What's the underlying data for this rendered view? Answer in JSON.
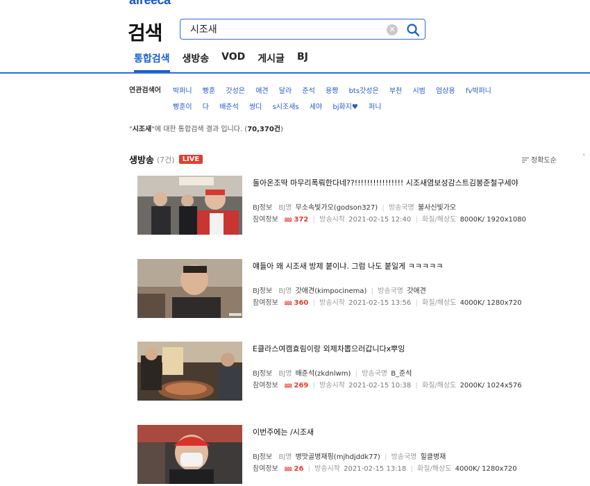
{
  "header": {
    "logo_text": "afreeca",
    "title": "검색"
  },
  "search": {
    "value": "시조새",
    "clear_icon": "clear-icon",
    "button_icon": "search-icon",
    "accent": "#2a6ce0"
  },
  "tabs": [
    {
      "label": "통합검색",
      "active": true
    },
    {
      "label": "생방송"
    },
    {
      "label": "VOD"
    },
    {
      "label": "게시글"
    },
    {
      "label": "BJ"
    }
  ],
  "related": {
    "label": "연관검색어",
    "items": [
      "박퍼니",
      "빵훈",
      "갓성은",
      "애견",
      "달라",
      "준석",
      "용짱",
      "bts갓성은",
      "부천",
      "시범",
      "엄상용",
      "fv박퍼니",
      "빵훈이",
      "다",
      "배준석",
      "쌍디",
      "s시조새s",
      "세야",
      "bj화지♥",
      "퍼니"
    ]
  },
  "summary": {
    "prefix": "\"",
    "query": "시조새",
    "mid": "\"에 대한 통합검색 결과 입니다. (",
    "count": "70,370건",
    "suffix": ")"
  },
  "live_section": {
    "title": "생방송",
    "count": "(7건)",
    "badge": "LIVE",
    "sort_label": "정확도순",
    "sort_icon": "sort-icon",
    "chevron": "˅"
  },
  "labels": {
    "bj_info": "BJ정보",
    "bj_name": "BJ명",
    "station": "방송국명",
    "viewers": "참여정보",
    "start": "방송시작",
    "quality": "화질/해상도"
  },
  "streams": [
    {
      "title": "돌아온조딱 마무리폭뤄한다네??!!!!!!!!!!!!!!!! 시조새염보성감스트김봉준철구세야",
      "bj": "무소속빛가오(godson327)",
      "station": "불사신빛가오",
      "viewers": "372",
      "start": "2021-02-15 12:40",
      "quality": "8000K/ 1920x1080"
    },
    {
      "title": "얘들아 왜 시조새 방제 붙이냐. 그럼 나도 붙일게 ㅋㅋㅋㅋㅋ",
      "bj": "갓애견(kimpocinema)",
      "station": "갓애견",
      "viewers": "360",
      "start": "2021-02-15 13:56",
      "quality": "4000K/ 1280x720"
    },
    {
      "title": "E클라스여캠효림이랑 외제차뽑으러갑니다x뿌잉",
      "bj": "배준석(zkdnlwm)",
      "station": "B_준석",
      "viewers": "269",
      "start": "2021-02-15 10:38",
      "quality": "2000K/ 1024x576"
    },
    {
      "title": "이번주에는 /시조새",
      "bj": "병맛골병재핑(mjhdjddk77)",
      "station": "힐클병재",
      "viewers": "26",
      "start": "2021-02-15 13:18",
      "quality": "4000K/ 1280x720"
    }
  ]
}
